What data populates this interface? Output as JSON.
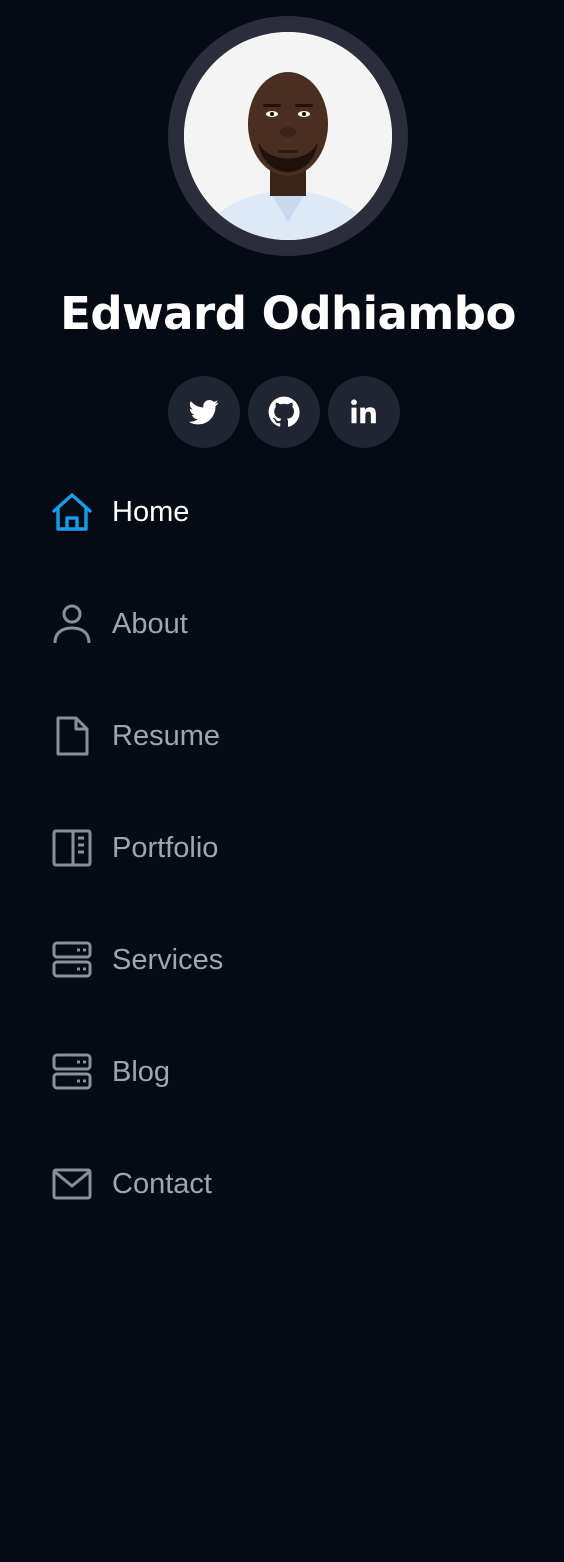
{
  "profile": {
    "name": "Edward Odhiambo"
  },
  "social": [
    {
      "icon": "twitter-icon"
    },
    {
      "icon": "github-icon"
    },
    {
      "icon": "linkedin-icon"
    }
  ],
  "nav": {
    "items": [
      {
        "label": "Home",
        "icon": "home-icon",
        "active": true
      },
      {
        "label": "About",
        "icon": "person-icon",
        "active": false
      },
      {
        "label": "Resume",
        "icon": "file-icon",
        "active": false
      },
      {
        "label": "Portfolio",
        "icon": "book-half-icon",
        "active": false
      },
      {
        "label": "Services",
        "icon": "server-icon",
        "active": false
      },
      {
        "label": "Blog",
        "icon": "server-icon",
        "active": false
      },
      {
        "label": "Contact",
        "icon": "envelope-icon",
        "active": false
      }
    ]
  },
  "colors": {
    "background": "#050a14",
    "accent": "#1a9bea",
    "icon": "#8b8f9c",
    "social_button": "#212431",
    "avatar_ring": "#2b2d3a"
  }
}
